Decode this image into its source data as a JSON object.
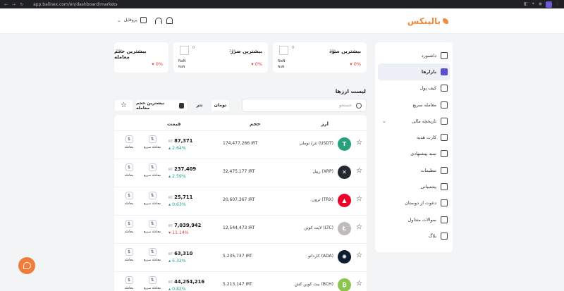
{
  "browser": {
    "url": "app.balinex.com/en/dashboard/markets"
  },
  "header": {
    "logo": "بالینکس",
    "profile": "پروفایل"
  },
  "sidebar": {
    "items": [
      {
        "label": "داشبورد",
        "icon": "grid-icon"
      },
      {
        "label": "بازارها",
        "icon": "chart-icon",
        "active": true
      },
      {
        "label": "کیف پول",
        "icon": "wallet-icon"
      },
      {
        "label": "معامله سریع",
        "icon": "swap-icon"
      },
      {
        "label": "تاریخچه مالی",
        "icon": "history-icon",
        "has_chevron": true
      },
      {
        "label": "کارت هدیه",
        "icon": "gift-icon"
      },
      {
        "label": "سبد پیشنهادی",
        "icon": "basket-icon"
      },
      {
        "label": "تنظیمات",
        "icon": "settings-icon"
      },
      {
        "label": "پشتیبانی",
        "icon": "support-icon"
      },
      {
        "label": "دعوت از دوستان",
        "icon": "invite-icon"
      },
      {
        "label": "سوالات متداول",
        "icon": "faq-icon"
      },
      {
        "label": "بلاگ",
        "icon": "blog-icon"
      }
    ]
  },
  "cards": [
    {
      "title": "بیشترین سود",
      "period": "24h",
      "count": "0",
      "name": "NaN",
      "sub": "NaN",
      "change": "0%"
    },
    {
      "title": "بیشترین ضرر",
      "period": "24h",
      "count": "0",
      "name": "NaN",
      "sub": "NaN",
      "change": "0%"
    },
    {
      "title": "بیشترین حجم معامله",
      "period": "24h",
      "change": "0%"
    }
  ],
  "list": {
    "title": "لیست ارزها",
    "search_placeholder": "جستجو",
    "tab_toman": "تومان",
    "tab_tether": "تتر",
    "sort_label": "بیشترین حجم معامله",
    "headers": {
      "coin": "ارز",
      "volume": "حجم",
      "price": "قیمت"
    },
    "quick_trade_label": "معامله سریع",
    "trade_label": "معامله",
    "rows": [
      {
        "name": "تتر/ تومان (USDT)",
        "volume": "174,477,266 IRT",
        "price": "87,371",
        "currency": "IRT",
        "change": "2.64%",
        "direction": "up",
        "symbol": "T",
        "color": "#26a17b"
      },
      {
        "name": "ریپل (XRP)",
        "volume": "32,475,177 IRT",
        "price": "237,409",
        "currency": "IRT",
        "change": "2.59%",
        "direction": "up",
        "symbol": "✕",
        "color": "#23292f"
      },
      {
        "name": "ترون (TRX)",
        "volume": "20,607,367 IRT",
        "price": "25,711",
        "currency": "IRT",
        "change": "0.63%",
        "direction": "up",
        "symbol": "▲",
        "color": "#eb0029"
      },
      {
        "name": "لایت کوین (LTC)",
        "volume": "12,544,473 IRT",
        "price": "7,039,942",
        "currency": "IRT",
        "change": "11.14%",
        "direction": "down",
        "symbol": "Ł",
        "color": "#bfbbbb"
      },
      {
        "name": "کاردانو (ADA)",
        "volume": "5,235,737 IRT",
        "price": "63,310",
        "currency": "IRT",
        "change": "5.32%",
        "direction": "up",
        "symbol": "✺",
        "color": "#0d1e30"
      },
      {
        "name": "بیت کوین کش (BCH)",
        "volume": "5,213,147 IRT",
        "price": "44,254,216",
        "currency": "IRT",
        "change": "0.82%",
        "direction": "up",
        "symbol": "₿",
        "color": "#8dc351"
      }
    ]
  },
  "colors": {
    "accent": "#f08a3c",
    "up": "#1f9d8f",
    "down": "#e03b3b",
    "active": "#5a4fcf"
  }
}
